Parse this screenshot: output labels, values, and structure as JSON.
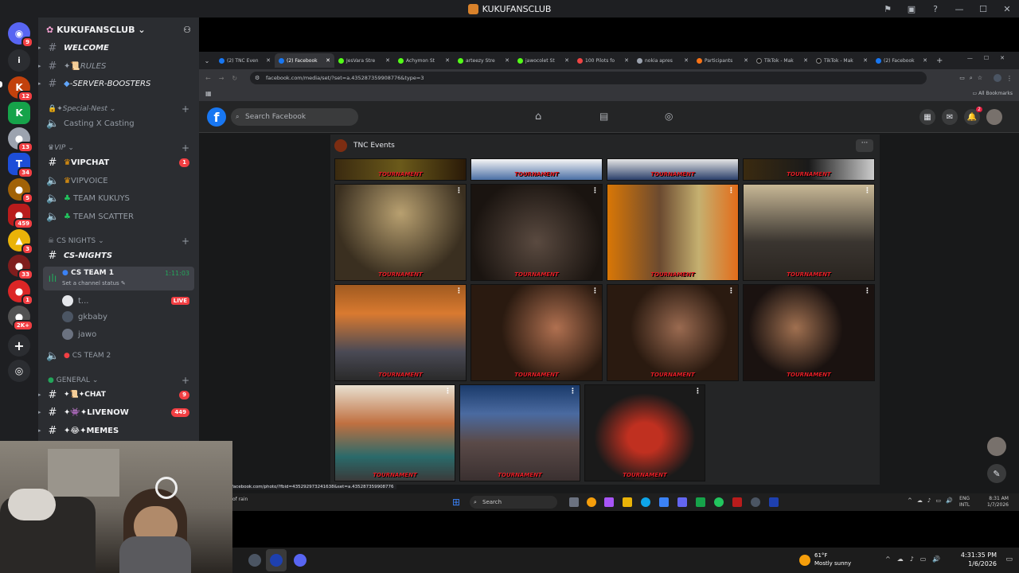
{
  "window": {
    "title": "KUKUFANSCLUB"
  },
  "server": {
    "name": "KUKUFANSCLUB"
  },
  "rail": {
    "badges": [
      "9",
      "12",
      "13",
      "34",
      "5",
      "459",
      "3",
      "33",
      "1",
      "2K+"
    ]
  },
  "channels": {
    "welcome": "WELCOME",
    "rules": "RULES",
    "boosters": "-SERVER-BOOSTERS",
    "special_cat": "Special-Nest",
    "casting": "Casting X Casting",
    "vip_cat": "VIP",
    "vipchat": "VIPCHAT",
    "vipchat_badge": "1",
    "vipvoice": "VIPVOICE",
    "kukuys": "TEAM KUKUYS",
    "scatter": "TEAM SCATTER",
    "csn_cat": "CS NIGHTS",
    "csnights": "CS-NIGHTS",
    "csteam1": "CS TEAM 1",
    "csteam1_time": "1:11:03",
    "status_hint": "Set a channel status",
    "user1": "t...",
    "live": "LIVE",
    "user2": "gkbaby",
    "user3": "jawo",
    "csteam2": "CS TEAM 2",
    "general_cat": "GENERAL",
    "chat": "CHAT",
    "chat_badge": "9",
    "livenow": "LIVENOW",
    "livenow_badge": "449",
    "memes": "MEMES"
  },
  "browser": {
    "tabs": [
      "(2) TNC Even",
      "(2) Facebook",
      "JesVara Stre",
      "Achymon St",
      "arteezy Stre",
      "jawocolet St",
      "100 Pilots fo",
      "nokia apres",
      "Participants",
      "TikTok - Mak",
      "TikTok - Mak",
      "(2) Facebook"
    ],
    "url": "facebook.com/media/set/?set=a.435287359908776&type=3",
    "bookmarks": "All Bookmarks",
    "fb_search": "Search Facebook",
    "album_owner": "TNC Events",
    "photo_watermark": "TOURNAMENT",
    "status_url": "facebook.com/photo/?fbid=435292973241638&set=a.435287359908776",
    "notif_count": "2"
  },
  "inner_taskbar": {
    "search": "Search",
    "weather_text": "of rain",
    "lang1": "ENG",
    "lang2": "INTL",
    "time": "8:31 AM",
    "date": "1/7/2026"
  },
  "outer_taskbar": {
    "weather_temp": "61°F",
    "weather_desc": "Mostly sunny",
    "time": "4:31:35 PM",
    "date": "1/6/2026"
  },
  "colors": {
    "discord_bg": "#2b2d31",
    "rail_bg": "#1e1f22",
    "fb_blue": "#1877f2",
    "live_red": "#f23f43",
    "voice_green": "#23a55a"
  }
}
